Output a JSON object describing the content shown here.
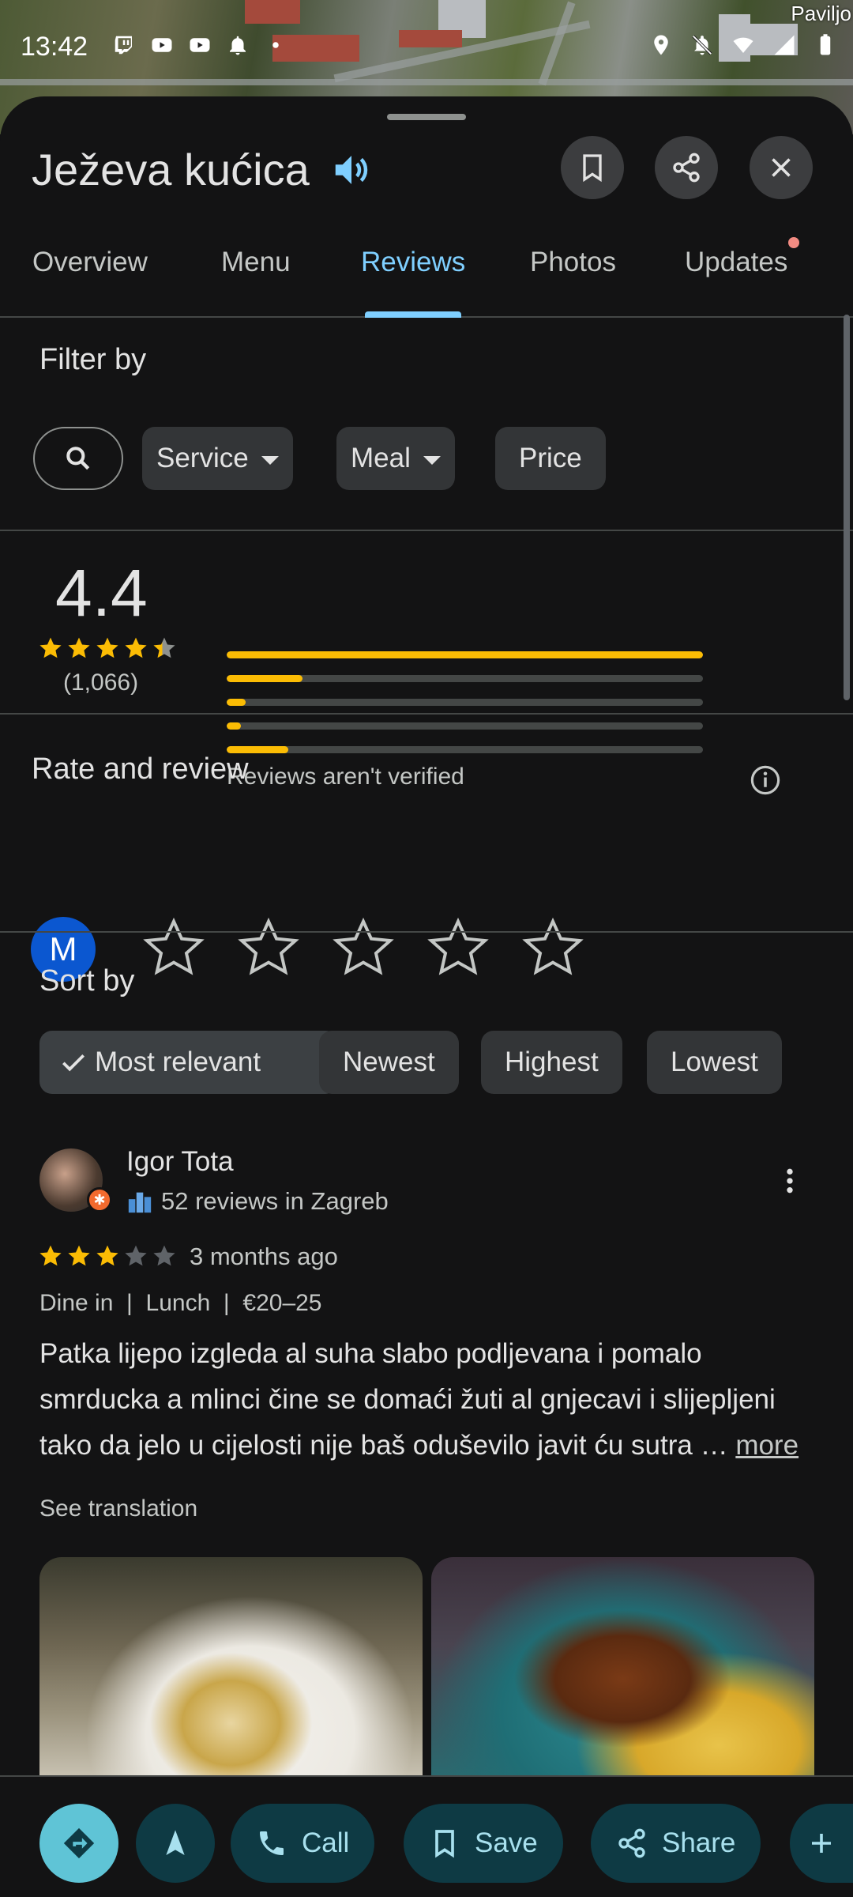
{
  "status_bar": {
    "time": "13:42",
    "map_label": "Paviljo"
  },
  "header": {
    "title": "Ježeva kućica",
    "icons": [
      "speaker-icon",
      "bookmark-icon",
      "share-icon",
      "close-icon"
    ]
  },
  "tabs": [
    {
      "label": "Overview",
      "active": false
    },
    {
      "label": "Menu",
      "active": false
    },
    {
      "label": "Reviews",
      "active": true
    },
    {
      "label": "Photos",
      "active": false
    },
    {
      "label": "Updates",
      "active": false,
      "has_dot": true
    }
  ],
  "filter": {
    "title": "Filter by",
    "chips": [
      {
        "label": "Service",
        "dropdown": true
      },
      {
        "label": "Meal",
        "dropdown": true
      },
      {
        "label": "Price",
        "dropdown": false
      }
    ]
  },
  "summary": {
    "rating": "4.4",
    "stars": 4.4,
    "count": "(1,066)",
    "bars": [
      {
        "stars": 5,
        "fraction": 1.0
      },
      {
        "stars": 4,
        "fraction": 0.16
      },
      {
        "stars": 3,
        "fraction": 0.04
      },
      {
        "stars": 2,
        "fraction": 0.03
      },
      {
        "stars": 1,
        "fraction": 0.13
      }
    ],
    "note": "Reviews aren't verified",
    "colors": {
      "star": "#fbbc04",
      "track": "#444746"
    }
  },
  "rate": {
    "title": "Rate and review",
    "avatar_letter": "M",
    "empty_stars": 5
  },
  "sort": {
    "title": "Sort by",
    "options": [
      {
        "label": "Most relevant",
        "selected": true
      },
      {
        "label": "Newest",
        "selected": false
      },
      {
        "label": "Highest",
        "selected": false
      },
      {
        "label": "Lowest",
        "selected": false
      }
    ]
  },
  "review": {
    "name": "Igor Tota",
    "meta": "52 reviews in Zagreb",
    "stars": 3,
    "time": "3 months ago",
    "tags": "Dine in  |  Lunch  |  €20–25",
    "text": "Patka lijepo izgleda al suha slabo podljevana i pomalo smrducka a mlinci čine se domaći žuti al gnjecavi i slijepljeni tako da jelo u cijelosti nije baš oduševilo javit ću sutra …",
    "more": "more",
    "translation": "See translation"
  },
  "bottom_bar": {
    "call": "Call",
    "save": "Save",
    "share": "Share",
    "colors": {
      "accent": "#5fc4d6",
      "pill_bg": "#0e3a44",
      "pill_text": "#a8e0ee"
    }
  }
}
